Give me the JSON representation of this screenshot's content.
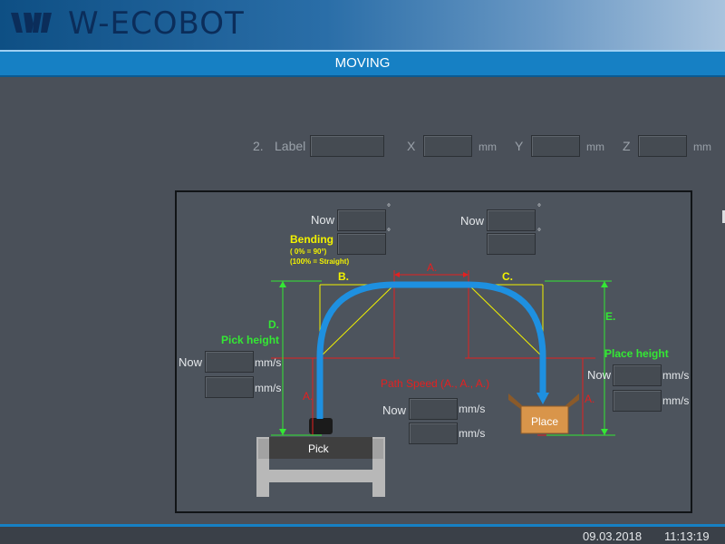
{
  "app": {
    "title": "W-ECOBOT"
  },
  "screen": {
    "title": "MOVING"
  },
  "coordinates": {
    "index": "2.",
    "label_caption": "Label",
    "label_value": "",
    "x_label": "X",
    "x_value": "",
    "x_unit": "mm",
    "y_label": "Y",
    "y_value": "",
    "y_unit": "mm",
    "z_label": "Z",
    "z_value": "",
    "z_unit": "mm"
  },
  "diagram": {
    "now": "Now",
    "degree": "°",
    "bending_title": "Bending",
    "bending_note1": "( 0% = 90°)",
    "bending_note2": "(100% = Straight)",
    "label_a": "A.",
    "label_b": "B.",
    "label_c": "C.",
    "label_d": "D.",
    "label_e": "E.",
    "pick_height": "Pick height",
    "place_height": "Place height",
    "path_speed": "Path Speed (A., A., A.)",
    "speed_unit": "mm/s",
    "pick_label": "Pick",
    "place_label": "Place",
    "fields": {
      "bend_left_now": "",
      "bend_left_set": "",
      "bend_right_now": "",
      "bend_right_set": "",
      "pick_speed_now": "",
      "pick_speed_set": "",
      "path_speed_now": "",
      "path_speed_set": "",
      "place_speed_now": "",
      "place_speed_set": ""
    }
  },
  "status": {
    "date": "09.03.2018",
    "time": "11:13:19"
  },
  "colors": {
    "accent": "#1680c4",
    "path": "#1e90e0",
    "dimension_red": "#e42020",
    "guide_yellow": "#f2f200",
    "height_green": "#34e834",
    "place_box": "#d9954a"
  }
}
